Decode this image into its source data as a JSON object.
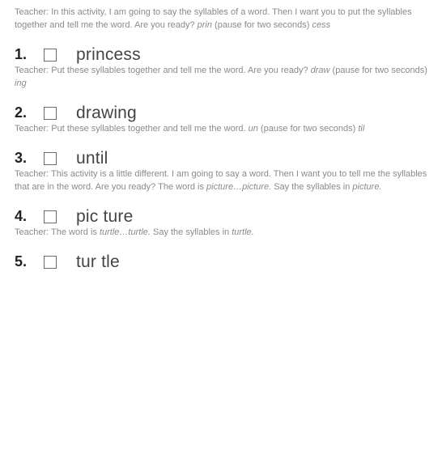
{
  "blocks": [
    {
      "instruction_segments": [
        {
          "text": "Teacher: In this activity, I am going to say the syllables of a word. Then I want you to put the syllables together and tell me the word. Are you ready? ",
          "italic": false
        },
        {
          "text": "prin",
          "italic": true
        },
        {
          "text": " (pause for two seconds) ",
          "italic": false
        },
        {
          "text": "cess",
          "italic": true
        }
      ],
      "number": "1.",
      "answer": "princess"
    },
    {
      "instruction_segments": [
        {
          "text": "Teacher: Put these syllables together and tell me the word. Are you ready? ",
          "italic": false
        },
        {
          "text": "draw",
          "italic": true
        },
        {
          "text": " (pause for two seconds) ",
          "italic": false
        },
        {
          "text": "ing",
          "italic": true
        }
      ],
      "number": "2.",
      "answer": "drawing"
    },
    {
      "instruction_segments": [
        {
          "text": "Teacher: Put these syllables together and tell me the word. ",
          "italic": false
        },
        {
          "text": "un",
          "italic": true
        },
        {
          "text": " (pause for two seconds) ",
          "italic": false
        },
        {
          "text": "til",
          "italic": true
        }
      ],
      "number": "3.",
      "answer": "until"
    },
    {
      "instruction_segments": [
        {
          "text": "Teacher: This activity is a little different. I am going to say a word. Then I want you to tell me the syllables that are in the word. Are you ready? The word is ",
          "italic": false
        },
        {
          "text": "picture…picture.",
          "italic": true
        },
        {
          "text": " Say the syllables in ",
          "italic": false
        },
        {
          "text": "picture.",
          "italic": true
        }
      ],
      "number": "4.",
      "answer": "pic ture"
    },
    {
      "instruction_segments": [
        {
          "text": "Teacher: The word is ",
          "italic": false
        },
        {
          "text": "turtle…turtle.",
          "italic": true
        },
        {
          "text": " Say the syllables in ",
          "italic": false
        },
        {
          "text": "turtle.",
          "italic": true
        }
      ],
      "number": "5.",
      "answer": "tur tle"
    }
  ]
}
